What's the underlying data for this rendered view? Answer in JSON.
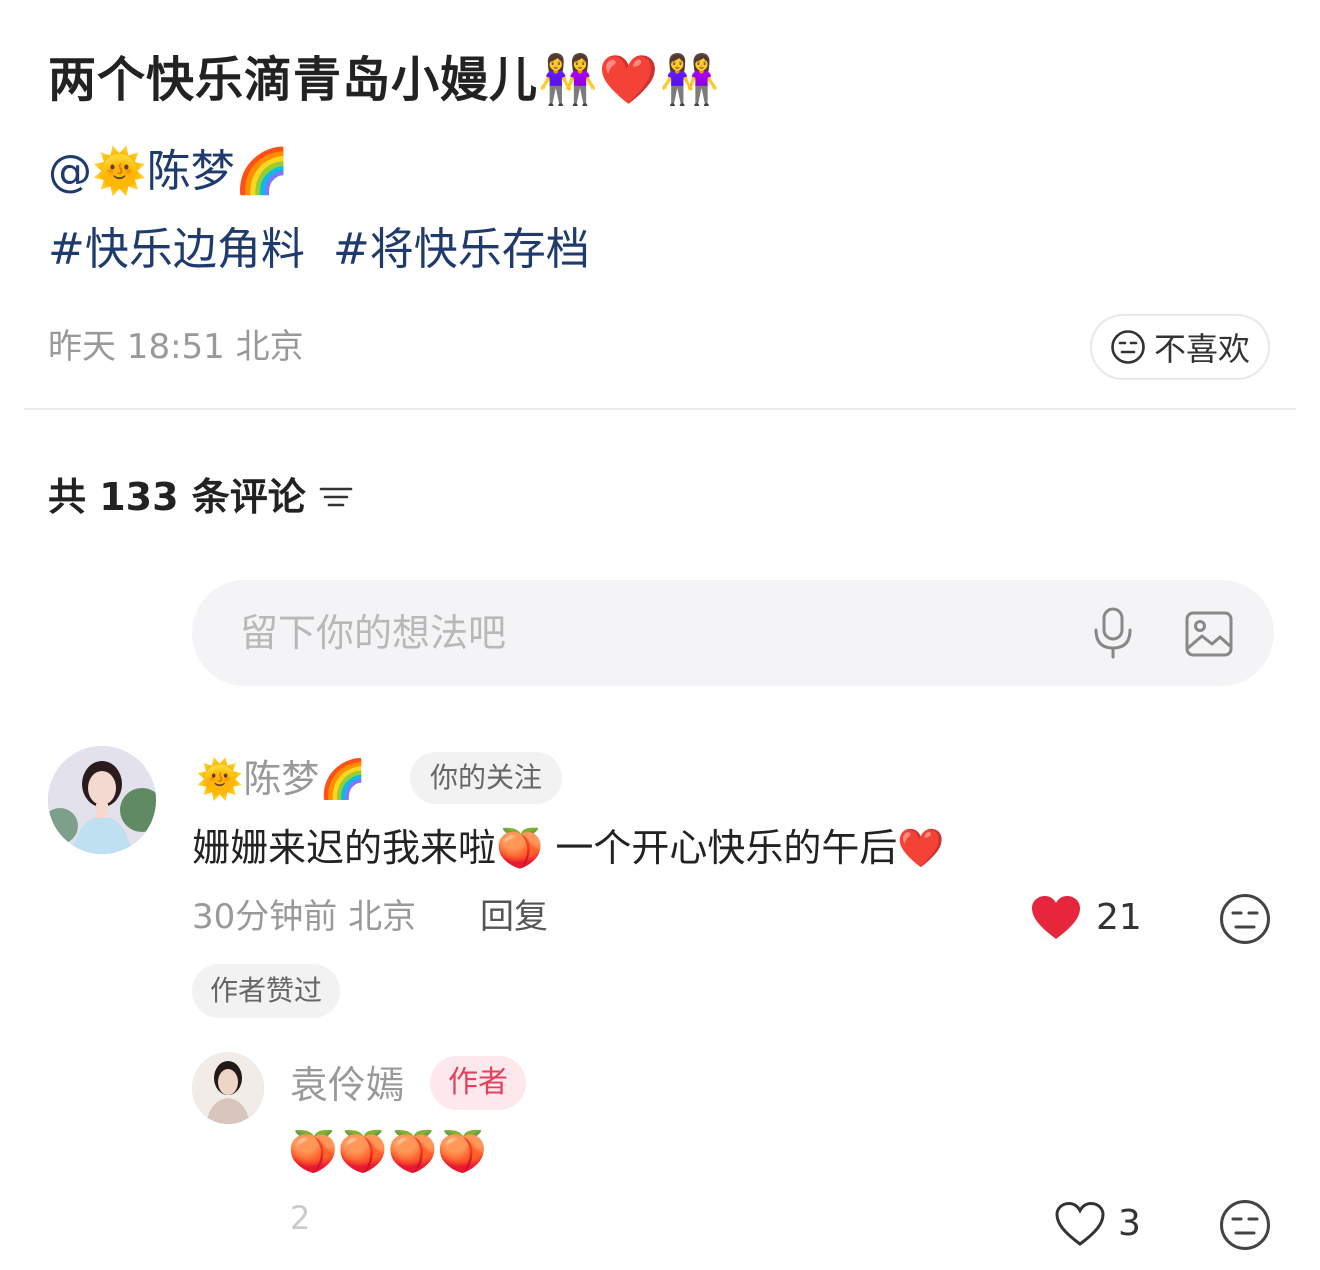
{
  "post": {
    "title": "两个快乐滴青岛小嫚儿👭❤️👭",
    "mention": "@🌞陈梦🌈",
    "tags": [
      "#快乐边角料",
      "#将快乐存档"
    ],
    "meta": "昨天 18:51 北京",
    "dislike_label": "不喜欢"
  },
  "comments_header": {
    "count_text": "共 133 条评论"
  },
  "comment_input": {
    "placeholder": "留下你的想法吧"
  },
  "comments": [
    {
      "name": "🌞陈梦🌈",
      "badge": "你的关注",
      "text": "姗姗来迟的我来啦🍑  一个开心快乐的午后❤️",
      "meta": "30分钟前 北京",
      "reply_label": "回复",
      "likes": "21",
      "author_liked": "作者赞过"
    },
    {
      "name": "袁伶嫣",
      "badge": "作者",
      "text": "🍑🍑🍑🍑",
      "meta": "2",
      "likes": "3"
    }
  ],
  "colors": {
    "link": "#1f3b6e",
    "like_red": "#e5263d",
    "author_badge_bg": "#fde8ec",
    "author_badge_text": "#e5405e"
  }
}
